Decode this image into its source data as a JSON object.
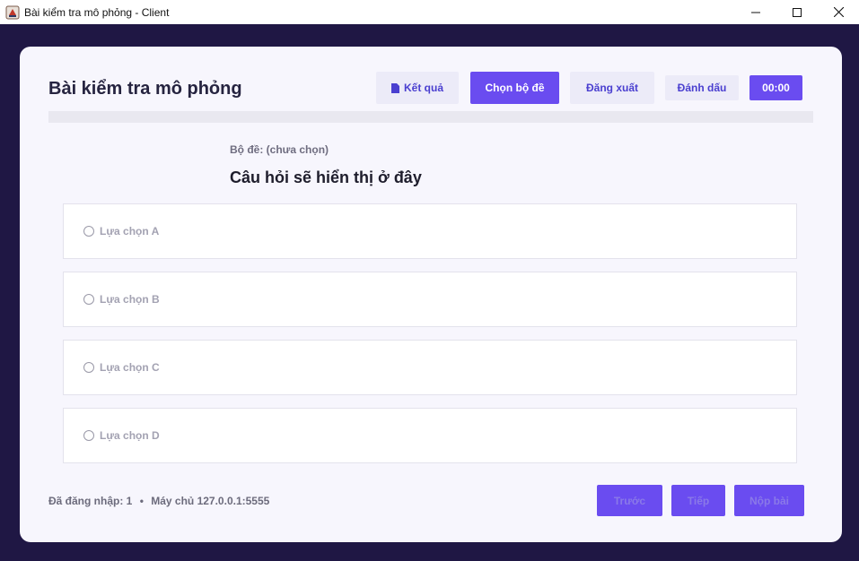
{
  "window": {
    "title": "Bài kiểm tra mô phỏng - Client"
  },
  "header": {
    "title": "Bài kiểm tra mô phỏng",
    "results_label": "Kết quả",
    "choose_set_label": "Chọn bộ đề",
    "logout_label": "Đăng xuất",
    "mark_label": "Đánh dấu",
    "timer": "00:00"
  },
  "progress": {
    "value": 0
  },
  "question": {
    "set_label": "Bộ đề: (chưa chọn)",
    "text": "Câu hỏi sẽ hiển thị ở đây",
    "options": [
      "Lựa chọn A",
      "Lựa chọn B",
      "Lựa chọn C",
      "Lựa chọn D"
    ]
  },
  "footer": {
    "logged_in": "Đã đăng nhập: 1",
    "separator": "•",
    "server": "Máy chủ 127.0.0.1:5555",
    "prev_label": "Trước",
    "next_label": "Tiếp",
    "submit_label": "Nộp bài"
  },
  "colors": {
    "accent": "#6a4cf0",
    "background": "#1f1744",
    "card": "#f7f6fd"
  }
}
